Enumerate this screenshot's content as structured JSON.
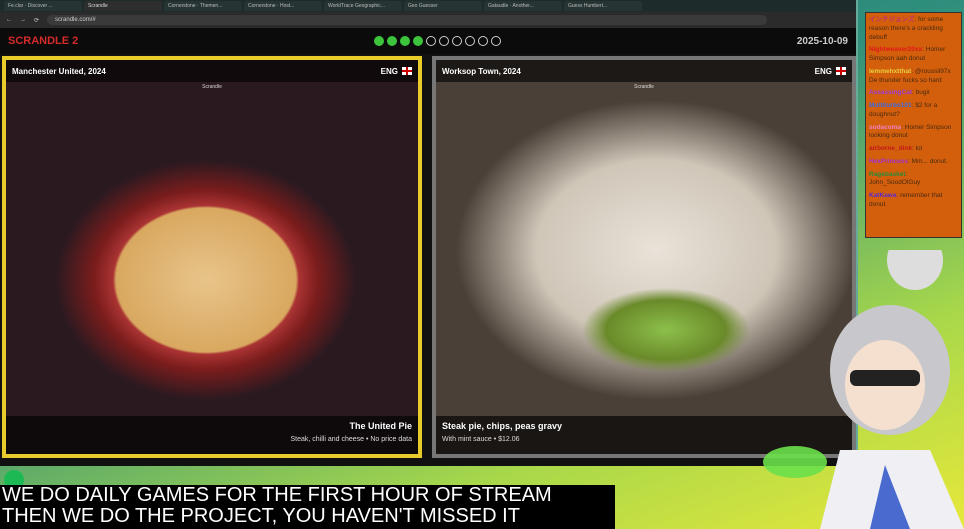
{
  "browser": {
    "tabs": [
      "Fe.clar · Discover ...",
      "Scrandle",
      "Cornerstone · Themen...",
      "Cornerstone · Host...",
      "WorldTrace Geographic...",
      "Geo Guesser",
      "Gataudle · Another...",
      "Guess Humbert..."
    ],
    "active_tab": 1,
    "url": "scrandle.com/#"
  },
  "app": {
    "title": "SCRANDLE 2",
    "date": "2025-10-09",
    "progress": {
      "done": 4,
      "total": 10
    }
  },
  "cards": [
    {
      "club": "Manchester United, 2024",
      "country": "ENG",
      "watermark": "Scrandle",
      "dish": "The United Pie",
      "details": "Steak, chilli and cheese • No price data",
      "selected": true
    },
    {
      "club": "Worksop Town, 2024",
      "country": "ENG",
      "watermark": "Scrandle",
      "dish": "Steak pie, chips, peas gravy",
      "details": "With mint sauce • $12.06",
      "selected": false
    }
  ],
  "chat": [
    {
      "user": "インチジョンズ",
      "color": "#c03070",
      "text": "for some reason there's a crackling debuff"
    },
    {
      "user": "Nightweaver20xx",
      "color": "#e01818",
      "text": "Homer Simpson aah donut"
    },
    {
      "user": "lemmehxtthat",
      "color": "#e8d040",
      "text": "@roussil97x De thunder fucks so hard"
    },
    {
      "user": "AssassingCat",
      "color": "#9a3ad8",
      "text": "bugir"
    },
    {
      "user": "Multiturbo101",
      "color": "#3a6ae0",
      "text": "$2 for a doughnut?"
    },
    {
      "user": "sodacoma",
      "color": "#f080c0",
      "text": "Homer Simpson looking donut"
    },
    {
      "user": "airborne_dink",
      "color": "#c01818",
      "text": "lol"
    },
    {
      "user": "HexPrincess",
      "color": "#a030d0",
      "text": "Mm... donut."
    },
    {
      "user": "Ragebasket",
      "color": "#2a8a3a",
      "text": "John_SoodOlGuy"
    },
    {
      "user": "KatKawa",
      "color": "#5a2ad0",
      "text": "remember that donut"
    }
  ],
  "caption": [
    "WE DO DAILY GAMES FOR THE FIRST HOUR OF STREAM",
    "THEN WE DO THE PROJECT, YOU HAVEN'T MISSED IT"
  ]
}
